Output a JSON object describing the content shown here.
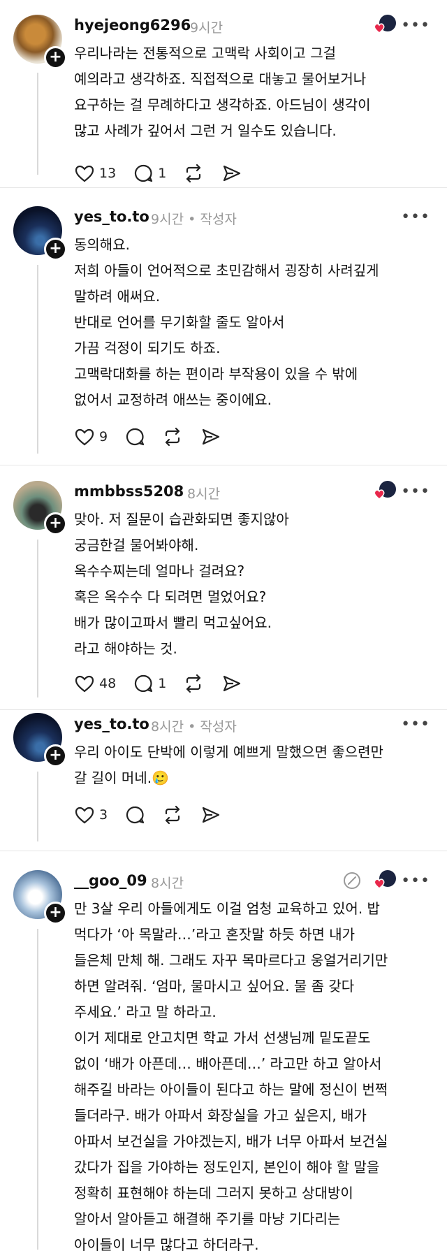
{
  "comments": [
    {
      "username": "hyejeong6296",
      "time": "9시간",
      "author_tag": "",
      "text": "우리나라는 전통적으로 고맥락 사회이고 그걸\n예의라고 생각하죠. 직접적으로 대놓고 물어보거나\n요구하는 걸 무례하다고 생각하죠. 아드님이 생각이\n많고 사례가 깊어서 그런 거 일수도 있습니다.",
      "likes": "13",
      "replies": "1"
    },
    {
      "username": "yes_to.to",
      "time": "9시간",
      "author_tag": "• 작성자",
      "text": "동의해요.\n저희 아들이 언어적으로 초민감해서 굉장히 사려깊게\n말하려 애써요.\n반대로 언어를 무기화할 줄도 알아서\n가끔 걱정이 되기도 하죠.\n고맥락대화를 하는 편이라 부작용이 있을 수 밖에\n없어서 교정하려 애쓰는 중이에요.",
      "likes": "9",
      "replies": ""
    },
    {
      "username": "mmbbss5208",
      "time": "8시간",
      "author_tag": "",
      "text": "맞아. 저 질문이 습관화되면 좋지않아\n궁금한걸 물어봐야해.\n옥수수찌는데 얼마나 걸려요?\n혹은 옥수수 다 되려면 멀었어요?\n배가 많이고파서 빨리 먹고싶어요.\n라고 해야하는 것.",
      "likes": "48",
      "replies": "1"
    },
    {
      "username": "yes_to.to",
      "time": "8시간",
      "author_tag": "• 작성자",
      "text": "우리 아이도 단박에 이렇게 예쁘게 말했으면 좋으련만\n갈 길이 머네.🥲",
      "likes": "3",
      "replies": ""
    },
    {
      "username": "__goo_09",
      "time": "8시간",
      "author_tag": "",
      "text": "만 3살 우리 아들에게도 이걸 엄청 교육하고 있어. 밥\n먹다가 ‘아 목말라…’라고 혼잣말 하듯 하면 내가\n들은체 만체 해. 그래도 자꾸 목마르다고 웅얼거리기만\n하면 알려줘. ‘엄마, 물마시고 싶어요. 물 좀 갖다\n주세요.’ 라고 말 하라고.\n이거 제대로 안고치면 학교 가서 선생님께 밑도끝도\n없이 ‘배가 아픈데… 배아픈데…’ 라고만 하고 알아서\n해주길 바라는 아이들이 된다고 하는 말에 정신이 번쩍\n들더라구. 배가 아파서 화장실을 가고 싶은지, 배가\n아파서 보건실을 가야겠는지, 배가 너무 아파서 보건실\n갔다가 집을 가야하는 정도인지, 본인이 해야 할 말을\n정확히 표현해야 하는데 그러지 못하고 상대방이\n알아서 알아듣고 해결해 주기를 마냥 기다리는\n아이들이 너무 많다고 하더라구.",
      "likes": "",
      "replies": ""
    }
  ],
  "ui": {
    "more_label": "•••",
    "plus_label": "+"
  },
  "colors": {
    "heart": "#e8274b",
    "muted": "#999999",
    "divider": "#e6e6e6"
  }
}
